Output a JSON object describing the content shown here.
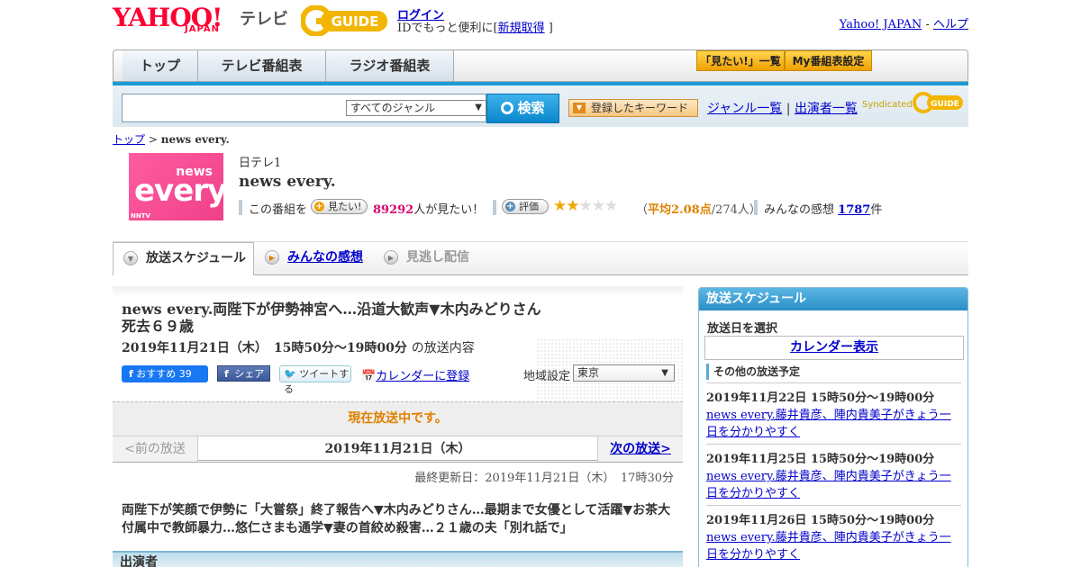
{
  "header": {
    "logo_yahoo": "YAHOO!",
    "logo_japan": "JAPAN",
    "logo_tv": "テレビ",
    "logo_gguide": "GUIDE",
    "login_label": "ログイン",
    "id_text_prefix": "IDでもっと便利に[",
    "signup_label": "新規取得",
    "id_text_suffix": "]",
    "yahoo_japan_link": "Yahoo! JAPAN",
    "separator": "-",
    "help_link": "ヘルプ"
  },
  "nav": {
    "tabs": [
      {
        "label": "トップ"
      },
      {
        "label": "テレビ番組表"
      },
      {
        "label": "ラジオ番組表"
      }
    ],
    "want_list_label": "「見たい!」一覧",
    "my_schedule_label": "My番組表設定"
  },
  "search": {
    "input_value": "",
    "genre_selected": "すべてのジャンル",
    "button_label": "検索",
    "keyword_label": "登録したキーワード",
    "genre_list_link": "ジャンル一覧",
    "divider": "|",
    "performer_list_link": "出演者一覧",
    "syndicated": "Syndicated",
    "gguide_small": "GUIDE"
  },
  "breadcrumb": {
    "home": "トップ",
    "sep": ">",
    "current": "news every."
  },
  "program": {
    "logo_top": "news",
    "logo_main": "every.",
    "logo_ntv": "NNTV",
    "channel": "日テレ1",
    "title": "news every.",
    "want_prefix": "この番組を",
    "want_button": "見たい!",
    "want_count": "89292",
    "want_suffix": "人が見たい！",
    "rate_button": "評価",
    "stars_filled": "★★",
    "stars_empty": "★★★",
    "avg_open": "（",
    "avg_label": "平均",
    "avg_value": "2.08点",
    "avg_rest": "/274人）",
    "reviews_prefix": "みんなの感想",
    "reviews_count": "1787",
    "reviews_suffix": "件"
  },
  "tabs": {
    "schedule": "放送スケジュール",
    "reviews": "みんなの感想",
    "vod": "見逃し配信"
  },
  "episode": {
    "title": "news every.両陛下が伊勢神宮へ…沿道大歓声▼木内みどりさん死去６９歳",
    "date": "2019年11月21日（木）　15時50分～19時00分",
    "date_suffix": "の放送内容",
    "fb_label": "おすすめ 39",
    "share_label": "シェア",
    "tweet_label": "ツイートする",
    "calendar_link": "カレンダーに登録",
    "region_label": "地域設定",
    "region_value": "東京",
    "now_on_air": "現在放送中です。",
    "prev_label": "<前の放送",
    "pager_date": "2019年11月21日（木）",
    "next_label": "次の放送>",
    "updated": "最終更新日：2019年11月21日（木）　17時30分",
    "description": "両陛下が笑顔で伊勢に「大嘗祭」終了報告へ▼木内みどりさん…最期まで女優として活躍▼お茶大付属中で教師暴力…悠仁さまも通学▼妻の首絞め殺害…２１歳の夫「別れ話で」",
    "cast_heading": "出演者"
  },
  "sidebar": {
    "heading": "放送スケジュール",
    "select_date": "放送日を選択",
    "calendar_display": "カレンダー表示",
    "other_heading": "その他の放送予定",
    "items": [
      {
        "date": "2019年11月22日  15時50分～19時00分",
        "title": "news every.藤井貴彦、陣内貴美子がきょう一日を分かりやすく"
      },
      {
        "date": "2019年11月25日  15時50分～19時00分",
        "title": "news every.藤井貴彦、陣内貴美子がきょう一日を分かりやすく"
      },
      {
        "date": "2019年11月26日  15時50分～19時00分",
        "title": "news every.藤井貴彦、陣内貴美子がきょう一日を分かりやすく"
      }
    ]
  },
  "colors": {
    "yahoo_red": "#ff0033",
    "nav_blue": "#1a9ad6",
    "accent_orange": "#e08000",
    "pink": "#d6006e",
    "logo_pink": "#f0408a"
  }
}
